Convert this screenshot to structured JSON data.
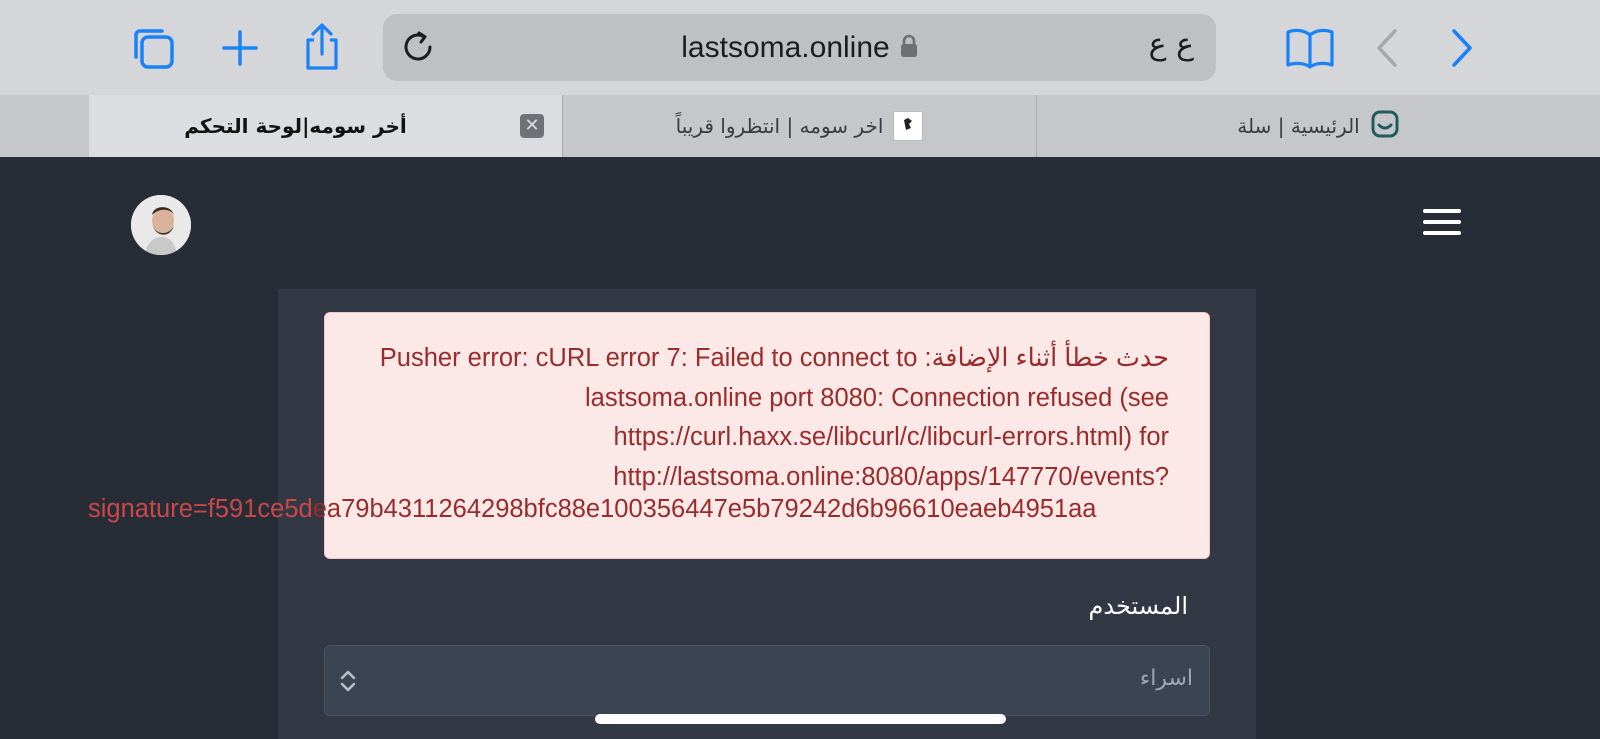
{
  "browser": {
    "url": "lastsoma.online",
    "text_size_label": "ع ع",
    "icons": {
      "tabs": "tabs-overview-icon",
      "new_tab": "plus-icon",
      "share": "share-icon",
      "reload": "reload-icon",
      "lock": "lock-icon",
      "bookmarks": "book-icon",
      "back": "chevron-left-icon",
      "forward": "chevron-right-icon"
    },
    "accent_color": "#1a82f7"
  },
  "tabs": [
    {
      "title": "أخر سومه|لوحة التحكم",
      "active": true,
      "close": "✕"
    },
    {
      "title": "اخر سومه | انتظروا قريباً",
      "active": false,
      "favicon_text": "أخر سومة"
    },
    {
      "title": "الرئيسية | سلة",
      "active": false
    }
  ],
  "alert": {
    "lines": [
      "حدث خطأ أثناء الإضافة: Pusher error: cURL error 7: Failed to connect to",
      "lastsoma.online port 8080: Connection refused (see",
      "https://curl.haxx.se/libcurl/c/libcurl-errors.html) for",
      "http://lastsoma.online:8080/apps/147770/events?"
    ],
    "overflow_outside": "signature=f591ce5d",
    "overflow_inside": "ea79b4311264298bfc88e100356447e5b79242d6b96610eaeb4951aa",
    "colors": {
      "background": "#fde8e8",
      "text": "#9b2c2c"
    }
  },
  "form": {
    "user_label": "المستخدم",
    "user_select_value": "اسراء"
  }
}
